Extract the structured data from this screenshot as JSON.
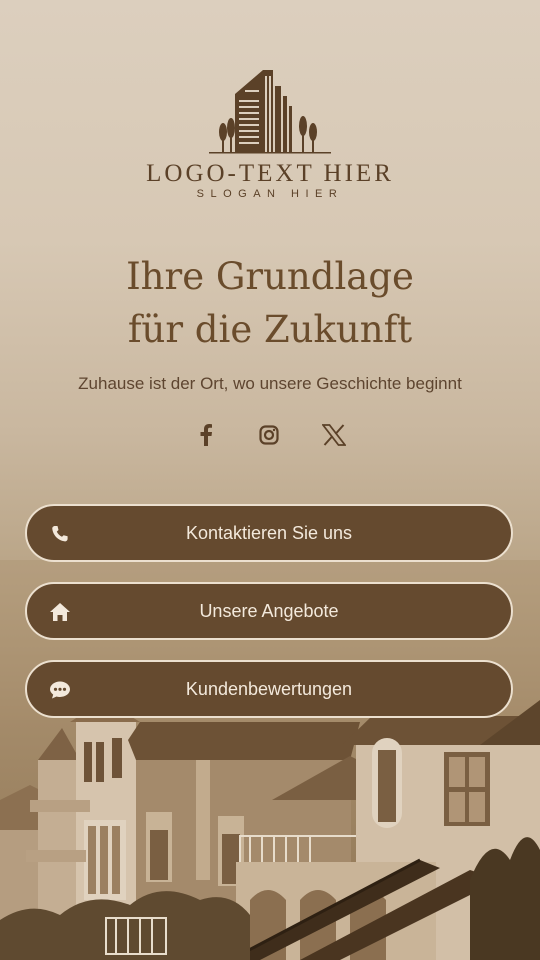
{
  "logo": {
    "text": "LOGO-TEXT HIER",
    "slogan": "SLOGAN HIER",
    "icon": "building-logo-icon"
  },
  "headline": {
    "line1": "Ihre Grundlage",
    "line2": "für die Zukunft"
  },
  "tagline": "Zuhause ist der Ort, wo unsere Geschichte beginnt",
  "social": [
    {
      "name": "facebook-icon"
    },
    {
      "name": "instagram-icon"
    },
    {
      "name": "x-twitter-icon"
    }
  ],
  "buttons": [
    {
      "label": "Kontaktieren Sie uns",
      "icon": "phone-icon"
    },
    {
      "label": "Unsere Angebote",
      "icon": "home-icon"
    },
    {
      "label": "Kundenbewertungen",
      "icon": "chat-bubble-icon"
    }
  ],
  "colors": {
    "brand": "#654a2f",
    "text": "#5b4128",
    "button_text": "#f3e9dc",
    "button_border": "#ece0cf"
  }
}
